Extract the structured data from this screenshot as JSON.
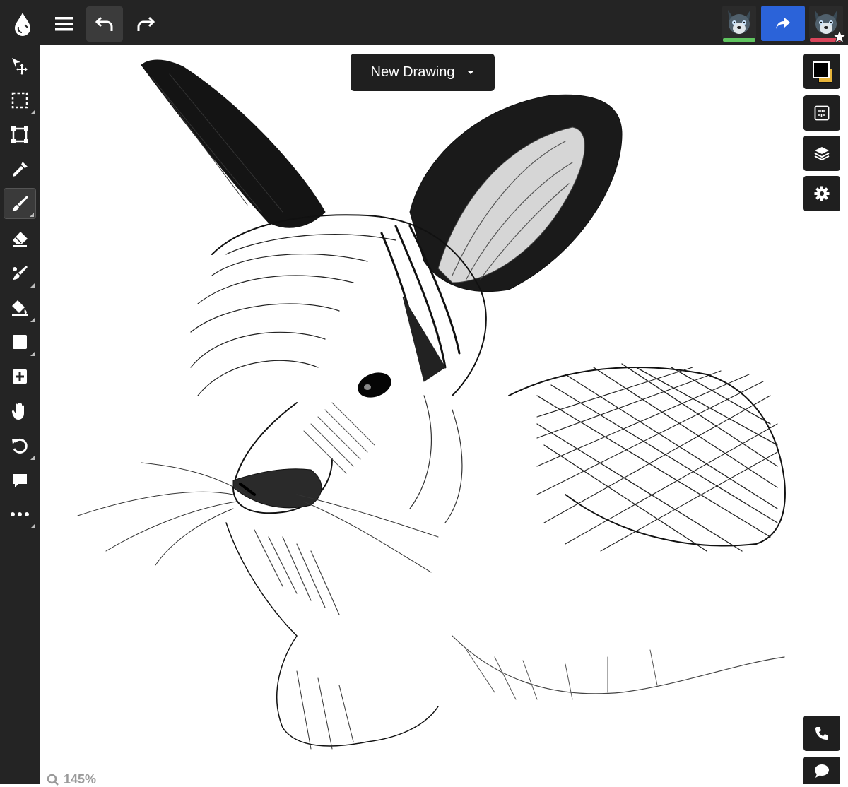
{
  "app": {
    "logo_icon": "droplet-icon"
  },
  "topbar": {
    "menu_icon": "hamburger-icon",
    "undo_icon": "undo-icon",
    "redo_icon": "redo-icon",
    "share_icon": "share-icon",
    "share_color": "#2b63d9",
    "users": [
      {
        "avatar_icon": "wolf-avatar",
        "status_color": "#5fc45f"
      },
      {
        "avatar_icon": "wolf-avatar",
        "status_color": "#d9455a",
        "badge_icon": "star-icon"
      }
    ]
  },
  "document": {
    "title": "New Drawing"
  },
  "tools": [
    {
      "name": "move-tool",
      "icon": "move-icon"
    },
    {
      "name": "select-tool",
      "icon": "marquee-icon"
    },
    {
      "name": "transform-tool",
      "icon": "transform-icon"
    },
    {
      "name": "eyedropper-tool",
      "icon": "eyedropper-icon"
    },
    {
      "name": "brush-tool",
      "icon": "brush-icon",
      "selected": true
    },
    {
      "name": "eraser-tool",
      "icon": "eraser-icon"
    },
    {
      "name": "blend-tool",
      "icon": "smudge-icon"
    },
    {
      "name": "fill-tool",
      "icon": "paint-bucket-icon"
    },
    {
      "name": "shape-tool",
      "icon": "square-icon"
    },
    {
      "name": "add-tool",
      "icon": "plus-square-icon"
    },
    {
      "name": "hand-tool",
      "icon": "hand-icon"
    },
    {
      "name": "rotate-tool",
      "icon": "rotate-icon"
    },
    {
      "name": "comment-tool",
      "icon": "speech-bubble-icon"
    },
    {
      "name": "more-tools",
      "icon": "ellipsis-icon"
    }
  ],
  "colors": {
    "primary": "#000000",
    "secondary": "#e8b53a"
  },
  "right_panel": {
    "buttons": [
      "color-swatch",
      "adjustments-icon",
      "layers-icon",
      "gear-icon"
    ],
    "bottom_buttons": [
      "phone-icon",
      "chat-icon"
    ]
  },
  "status": {
    "zoom": "145%"
  }
}
